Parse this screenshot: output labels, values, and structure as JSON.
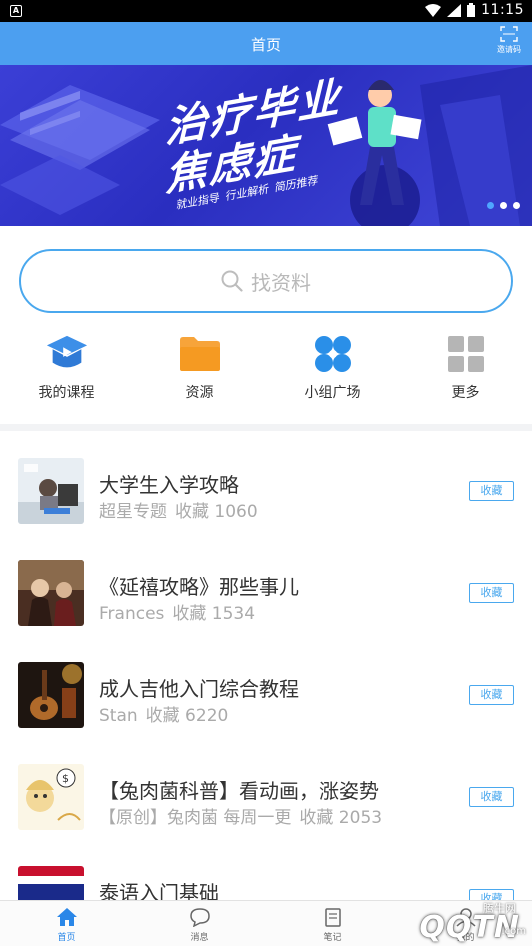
{
  "status_bar": {
    "time": "11:15",
    "notif_letter": "A"
  },
  "header": {
    "title": "首页",
    "invite_label": "邀请码"
  },
  "banner": {
    "line1": "治疗毕业",
    "line2": "焦虑症",
    "chips": [
      "就业指导",
      "行业解析",
      "简历推荐"
    ],
    "page_count": 3,
    "active_page": 1
  },
  "search": {
    "placeholder": "找资料"
  },
  "quick_nav": [
    {
      "label": "我的课程",
      "icon": "course-icon"
    },
    {
      "label": "资源",
      "icon": "folder-icon"
    },
    {
      "label": "小组广场",
      "icon": "group-icon"
    },
    {
      "label": "更多",
      "icon": "grid-icon"
    }
  ],
  "list": [
    {
      "title": "大学生入学攻略",
      "source": "超星专题",
      "fav_count": "收藏 1060",
      "button": "收藏"
    },
    {
      "title": "《延禧攻略》那些事儿",
      "source": "Frances",
      "fav_count": "收藏 1534",
      "button": "收藏"
    },
    {
      "title": "成人吉他入门综合教程",
      "source": "Stan",
      "fav_count": "收藏 6220",
      "button": "收藏"
    },
    {
      "title": "【兔肉菌科普】看动画，涨姿势",
      "source": "【原创】兔肉菌 每周一更",
      "fav_count": "收藏 2053",
      "button": "收藏"
    },
    {
      "title": "泰语入门基础",
      "source": "",
      "fav_count": "",
      "button": "收藏"
    }
  ],
  "tabbar": [
    {
      "label": "首页",
      "icon": "home-icon",
      "active": true
    },
    {
      "label": "消息",
      "icon": "message-icon",
      "active": false
    },
    {
      "label": "笔记",
      "icon": "note-icon",
      "active": false
    },
    {
      "label": "我的",
      "icon": "profile-icon",
      "active": false
    }
  ],
  "watermark": {
    "top": "腾牛网",
    "main": "QQTN",
    "domain": ".com"
  },
  "colors": {
    "accent": "#4c9ff0",
    "border_blue": "#4aa8ee",
    "tab_active": "#2a87e8"
  }
}
